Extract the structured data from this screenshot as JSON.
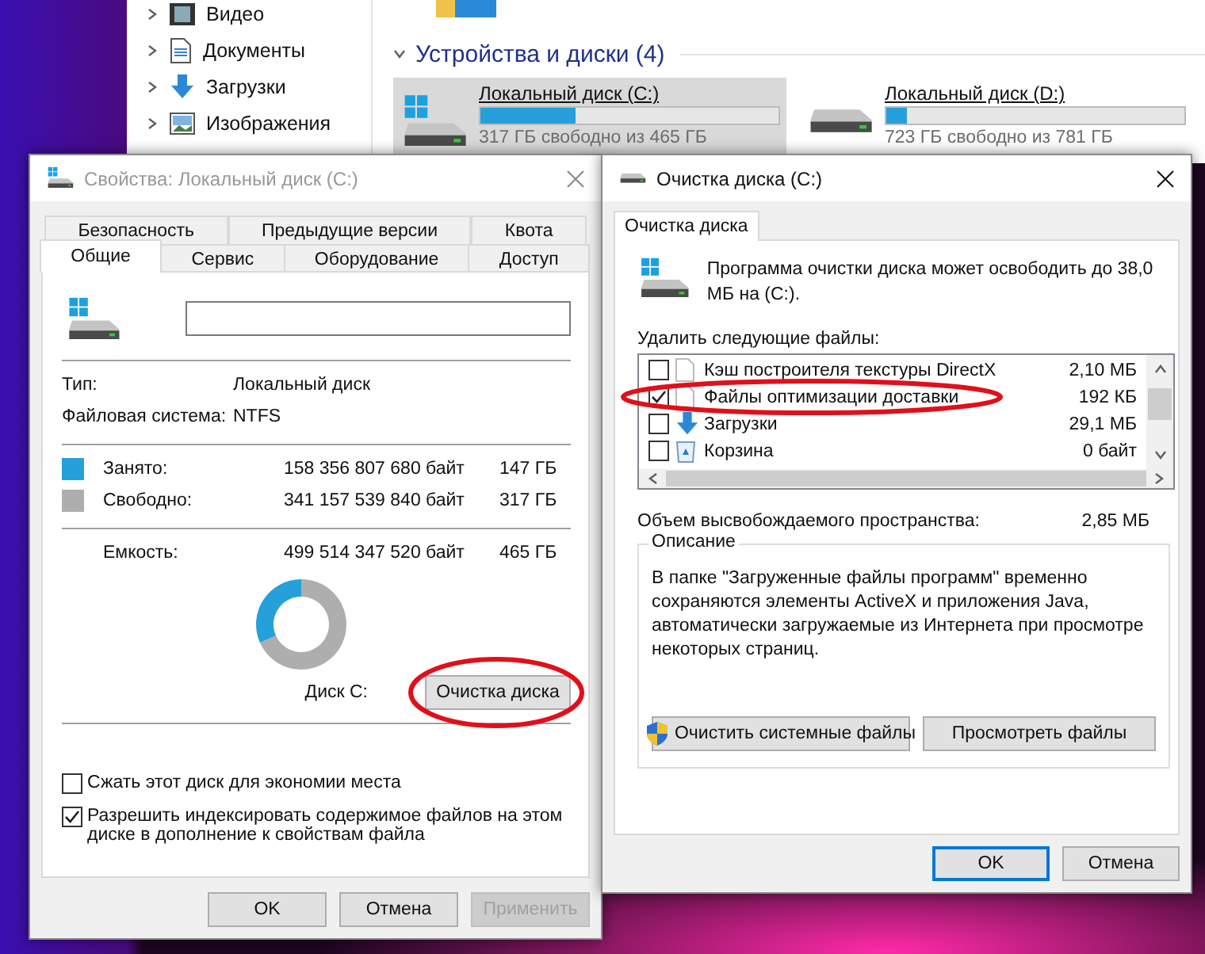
{
  "explorer": {
    "nav_items": [
      {
        "label": "Видео",
        "kind": "video"
      },
      {
        "label": "Документы",
        "kind": "documents"
      },
      {
        "label": "Загрузки",
        "kind": "downloads"
      },
      {
        "label": "Изображения",
        "kind": "images"
      }
    ],
    "section": {
      "title": "Устройства и диски (4)",
      "expanded": true
    },
    "drives": [
      {
        "name": "Локальный диск (C:)",
        "level": 0.32,
        "free": "317 ГБ свободно из 465 ГБ",
        "selected": true,
        "system": true
      },
      {
        "name": "Локальный диск (D:)",
        "level": 0.07,
        "free": "723 ГБ свободно из 781 ГБ",
        "selected": false,
        "system": false
      }
    ]
  },
  "properties_dialog": {
    "title": "Свойства: Локальный диск (C:)",
    "active": false,
    "back_tabs": [
      {
        "label": "Безопасность",
        "selected": false
      },
      {
        "label": "Предыдущие версии",
        "selected": false
      },
      {
        "label": "Квота",
        "selected": false
      }
    ],
    "front_tabs": [
      {
        "label": "Общие",
        "selected": true
      },
      {
        "label": "Сервис",
        "selected": false
      },
      {
        "label": "Оборудование",
        "selected": false
      },
      {
        "label": "Доступ",
        "selected": false
      }
    ],
    "info": [
      {
        "label": "Тип:",
        "value": "Локальный диск"
      },
      {
        "label": "Файловая система:",
        "value": "NTFS"
      }
    ],
    "space": [
      {
        "label": "Занято:",
        "bytes": "158 356 807 680 байт",
        "size": "147 ГБ",
        "color": "#26a0da"
      },
      {
        "label": "Свободно:",
        "bytes": "341 157 539 840 байт",
        "size": "317 ГБ",
        "color": "#aeaeae"
      }
    ],
    "capacity": {
      "label": "Емкость:",
      "bytes": "499 514 347 520 байт",
      "size": "465 ГБ"
    },
    "usage": {
      "chart_data": {
        "type": "donut",
        "values": [
          31.7,
          68.3
        ]
      }
    },
    "disk_label": "Диск C:",
    "cleanup_button": {
      "label": "Очистка диска",
      "circled": true
    },
    "options": [
      {
        "label": "Сжать этот диск для экономии места",
        "checked": false
      },
      {
        "label": "Разрешить индексировать содержимое файлов на этом диске в дополнение к свойствам файла",
        "checked": true
      }
    ],
    "buttons": [
      {
        "label": "OK",
        "disabled": false
      },
      {
        "label": "Отмена",
        "disabled": false
      },
      {
        "label": "Применить",
        "disabled": true
      }
    ]
  },
  "cleanup_dialog": {
    "title": "Очистка диска (C:)",
    "active": true,
    "tabs": [
      {
        "label": "Очистка диска",
        "selected": true
      }
    ],
    "intro": "Программа очистки диска может освободить до 38,0 МБ на (C:).",
    "list_label": "Удалить следующие файлы:",
    "files": [
      {
        "name": "Кэш построителя текстуры DirectX",
        "size": "2,10 МБ",
        "checked": false,
        "kind": "file",
        "circled": false
      },
      {
        "name": "Файлы оптимизации доставки",
        "size": "192 КБ",
        "checked": true,
        "kind": "file",
        "circled": true
      },
      {
        "name": "Загрузки",
        "size": "29,1 МБ",
        "checked": false,
        "kind": "download",
        "circled": false
      },
      {
        "name": "Корзина",
        "size": "0 байт",
        "checked": false,
        "kind": "recycle",
        "circled": false
      }
    ],
    "total_label": "Объем высвобождаемого пространства:",
    "total": "2,85 МБ",
    "description": {
      "title": "Описание",
      "text": "В папке \"Загруженные файлы программ\" временно сохраняются элементы ActiveX и приложения Java, автоматически загружаемые из Интернета при просмотре некоторых страниц."
    },
    "action_buttons": [
      {
        "label": "Очистить системные файлы",
        "kind": "shield"
      },
      {
        "label": "Просмотреть файлы",
        "kind": "plain"
      }
    ],
    "buttons": [
      {
        "label": "OK",
        "default": true
      },
      {
        "label": "Отмена",
        "default": false
      }
    ]
  }
}
